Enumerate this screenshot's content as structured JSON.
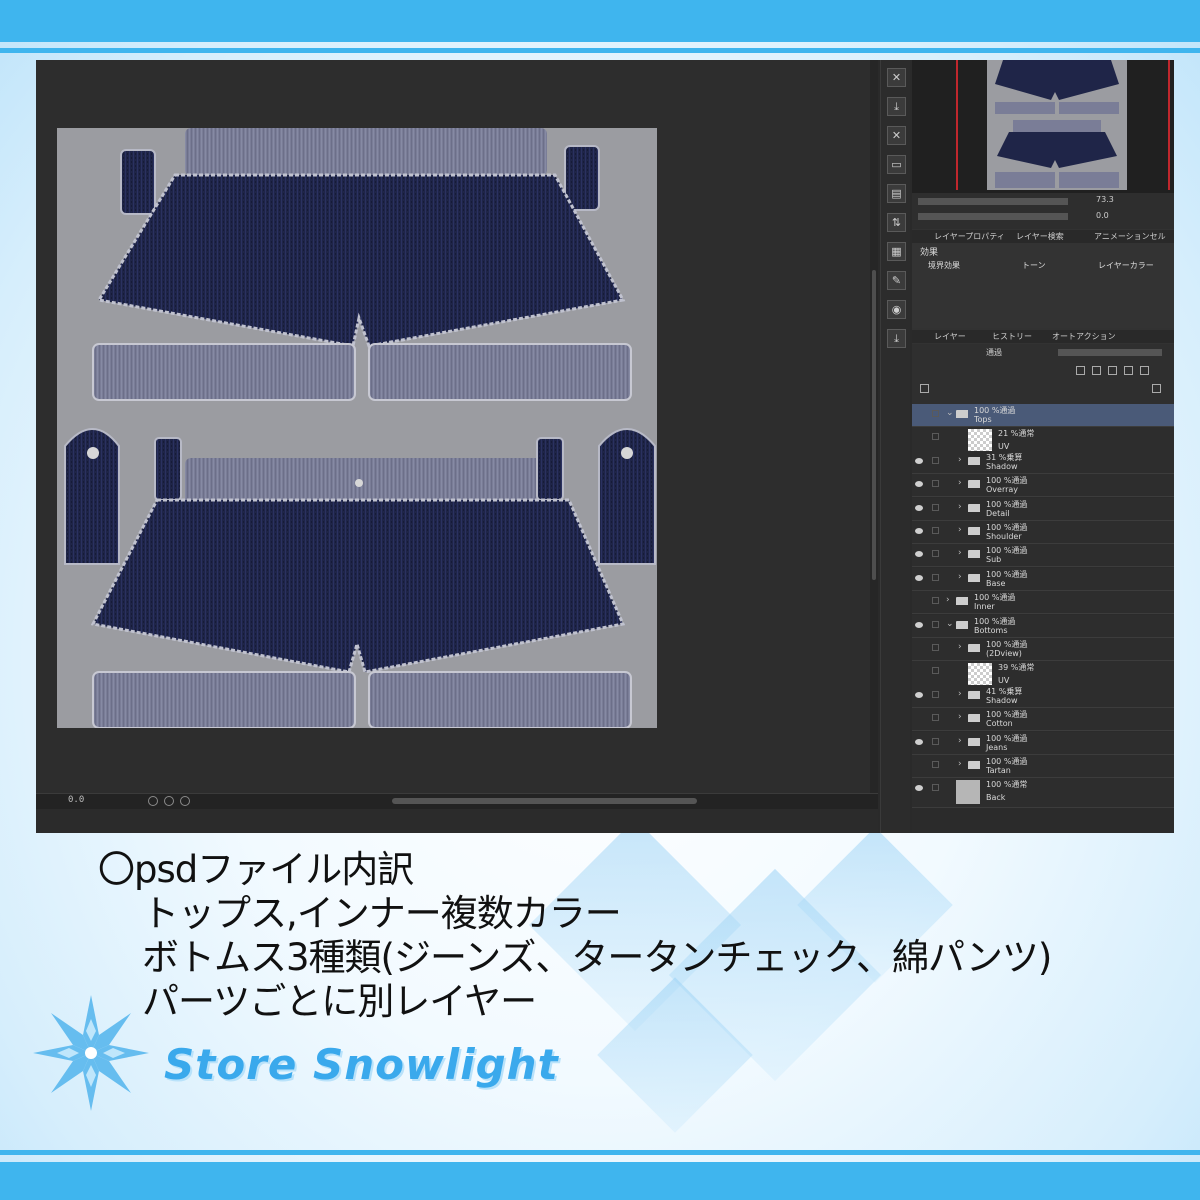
{
  "colors": {
    "accent_blue": "#3fb5ee",
    "denim": "#1f2548",
    "uv_background": "#9b9ca1",
    "app_dark": "#2a2a2a",
    "selected_layer": "#4a5a78"
  },
  "app": {
    "zoom_display": "0.0",
    "navigator": {
      "zoom": "73.3",
      "rotation": "0.0"
    },
    "layer_properties_tabs": [
      "レイヤープロパティ",
      "レイヤー検索",
      "アニメーションセル"
    ],
    "effect_label": "効果",
    "effects": [
      "境界効果",
      "トーン",
      "レイヤーカラー"
    ],
    "layer_tabs": [
      "レイヤー",
      "ヒストリー",
      "オートアクション"
    ],
    "blend_mode": "通過",
    "tool_icons": [
      "close-icon",
      "download-icon",
      "close-icon",
      "folder-icon",
      "save-icon",
      "transfer-icon",
      "grid-icon",
      "edit-icon",
      "camera-icon",
      "download-icon"
    ],
    "layers": [
      {
        "mode": "100 %通過",
        "name": "Tops",
        "depth": 0,
        "kind": "folder",
        "expanded": true,
        "visible": false,
        "selected": true
      },
      {
        "mode": "21 %通常",
        "name": "UV",
        "depth": 1,
        "kind": "raster",
        "visible": false
      },
      {
        "mode": "31 %乗算",
        "name": "Shadow",
        "depth": 1,
        "kind": "folder",
        "visible": true
      },
      {
        "mode": "100 %通過",
        "name": "Overray",
        "depth": 1,
        "kind": "folder",
        "visible": true
      },
      {
        "mode": "100 %通過",
        "name": "Detail",
        "depth": 1,
        "kind": "folder",
        "visible": true
      },
      {
        "mode": "100 %通過",
        "name": "Shoulder",
        "depth": 1,
        "kind": "folder",
        "visible": true
      },
      {
        "mode": "100 %通過",
        "name": "Sub",
        "depth": 1,
        "kind": "folder",
        "visible": true
      },
      {
        "mode": "100 %通過",
        "name": "Base",
        "depth": 1,
        "kind": "folder",
        "visible": true
      },
      {
        "mode": "100 %通過",
        "name": "Inner",
        "depth": 0,
        "kind": "folder",
        "visible": false
      },
      {
        "mode": "100 %通過",
        "name": "Bottoms",
        "depth": 0,
        "kind": "folder",
        "expanded": true,
        "visible": true
      },
      {
        "mode": "100 %通過",
        "name": "(2Dview)",
        "depth": 1,
        "kind": "folder",
        "visible": false
      },
      {
        "mode": "39 %通常",
        "name": "UV",
        "depth": 1,
        "kind": "raster",
        "visible": false
      },
      {
        "mode": "41 %乗算",
        "name": "Shadow",
        "depth": 1,
        "kind": "folder",
        "visible": true
      },
      {
        "mode": "100 %通過",
        "name": "Cotton",
        "depth": 1,
        "kind": "folder",
        "visible": false
      },
      {
        "mode": "100 %通過",
        "name": "Jeans",
        "depth": 1,
        "kind": "folder",
        "visible": true
      },
      {
        "mode": "100 %通過",
        "name": "Tartan",
        "depth": 1,
        "kind": "folder",
        "visible": false
      },
      {
        "mode": "100 %通常",
        "name": "Back",
        "depth": 0,
        "kind": "paper",
        "visible": true
      }
    ]
  },
  "caption": {
    "line1": "〇psdファイル内訳",
    "line2": "トップス,インナー複数カラー",
    "line3": "ボトムス3種類(ジーンズ、タータンチェック、綿パンツ)",
    "line4": "パーツごとに別レイヤー"
  },
  "logo": {
    "text": "Store Snowlight"
  }
}
